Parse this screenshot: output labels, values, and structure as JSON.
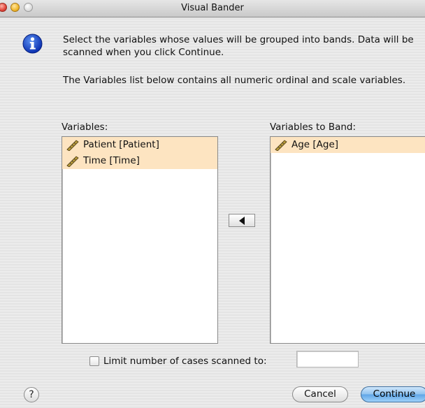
{
  "window": {
    "title": "Visual Bander"
  },
  "instructions": {
    "line1": "Select the variables whose values will be grouped into bands.  Data will be scanned when you click Continue.",
    "line2": "The Variables list below contains all numeric ordinal and scale variables."
  },
  "source_list": {
    "label": "Variables:",
    "items": [
      {
        "label": "Patient [Patient]",
        "icon": "ruler-icon"
      },
      {
        "label": "Time [Time]",
        "icon": "ruler-icon"
      }
    ]
  },
  "target_list": {
    "label": "Variables to Band:",
    "items": [
      {
        "label": "Age [Age]",
        "icon": "ruler-icon"
      }
    ]
  },
  "limit": {
    "label": "Limit number of cases scanned to:",
    "checked": false,
    "value": ""
  },
  "buttons": {
    "help": "?",
    "cancel": "Cancel",
    "continue": "Continue"
  },
  "colors": {
    "selection": "#fde4c1",
    "default_button": "#5fa5e6"
  }
}
